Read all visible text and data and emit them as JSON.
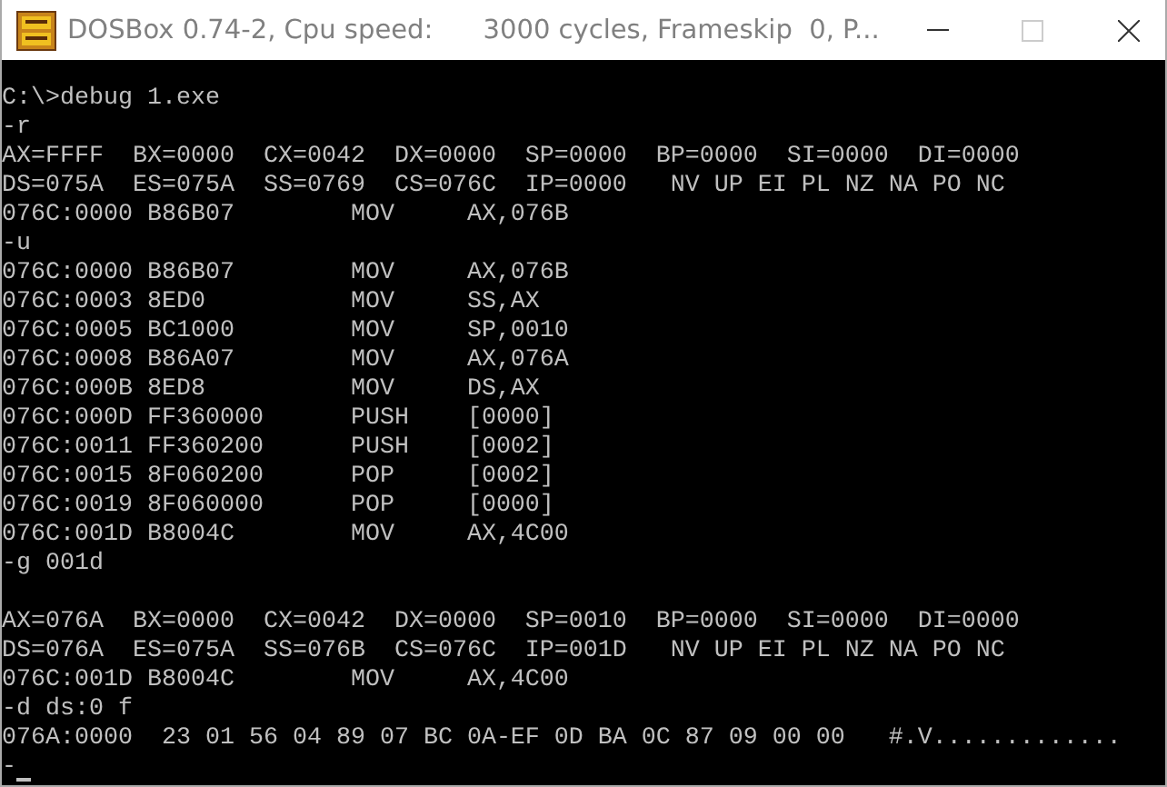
{
  "window": {
    "title": "DOSBox 0.74-2, Cpu speed:      3000 cycles, Frameskip  0, P...",
    "maximize_disabled": true
  },
  "terminal": {
    "lines": [
      {
        "kind": "text",
        "text": "C:\\>debug 1.exe"
      },
      {
        "kind": "text",
        "text": "-r"
      },
      {
        "kind": "text",
        "text": "AX=FFFF  BX=0000  CX=0042  DX=0000  SP=0000  BP=0000  SI=0000  DI=0000"
      },
      {
        "kind": "text",
        "text": "DS=075A  ES=075A  SS=0769  CS=076C  IP=0000   NV UP EI PL NZ NA PO NC"
      },
      {
        "kind": "text",
        "text": "076C:0000 B86B07        MOV     AX,076B"
      },
      {
        "kind": "text",
        "text": "-u"
      },
      {
        "kind": "text",
        "text": "076C:0000 B86B07        MOV     AX,076B"
      },
      {
        "kind": "text",
        "text": "076C:0003 8ED0          MOV     SS,AX"
      },
      {
        "kind": "text",
        "text": "076C:0005 BC1000        MOV     SP,0010"
      },
      {
        "kind": "text",
        "text": "076C:0008 B86A07        MOV     AX,076A"
      },
      {
        "kind": "text",
        "text": "076C:000B 8ED8          MOV     DS,AX"
      },
      {
        "kind": "text",
        "text": "076C:000D FF360000      PUSH    [0000]"
      },
      {
        "kind": "text",
        "text": "076C:0011 FF360200      PUSH    [0002]"
      },
      {
        "kind": "text",
        "text": "076C:0015 8F060200      POP     [0002]"
      },
      {
        "kind": "text",
        "text": "076C:0019 8F060000      POP     [0000]"
      },
      {
        "kind": "text",
        "text": "076C:001D B8004C        MOV     AX,4C00"
      },
      {
        "kind": "text",
        "text": "-g 001d"
      },
      {
        "kind": "blank"
      },
      {
        "kind": "text",
        "text": "AX=076A  BX=0000  CX=0042  DX=0000  SP=0010  BP=0000  SI=0000  DI=0000"
      },
      {
        "kind": "text",
        "text": "DS=076A  ES=075A  SS=076B  CS=076C  IP=001D   NV UP EI PL NZ NA PO NC"
      },
      {
        "kind": "text",
        "text": "076C:001D B8004C        MOV     AX,4C00"
      },
      {
        "kind": "text",
        "text": "-d ds:0 f"
      },
      {
        "kind": "text",
        "text": "076A:0000  23 01 56 04 89 07 BC 0A-EF 0D BA 0C 87 09 00 00   #.V............."
      },
      {
        "kind": "prompt",
        "text": "-",
        "cursor": true
      }
    ]
  }
}
